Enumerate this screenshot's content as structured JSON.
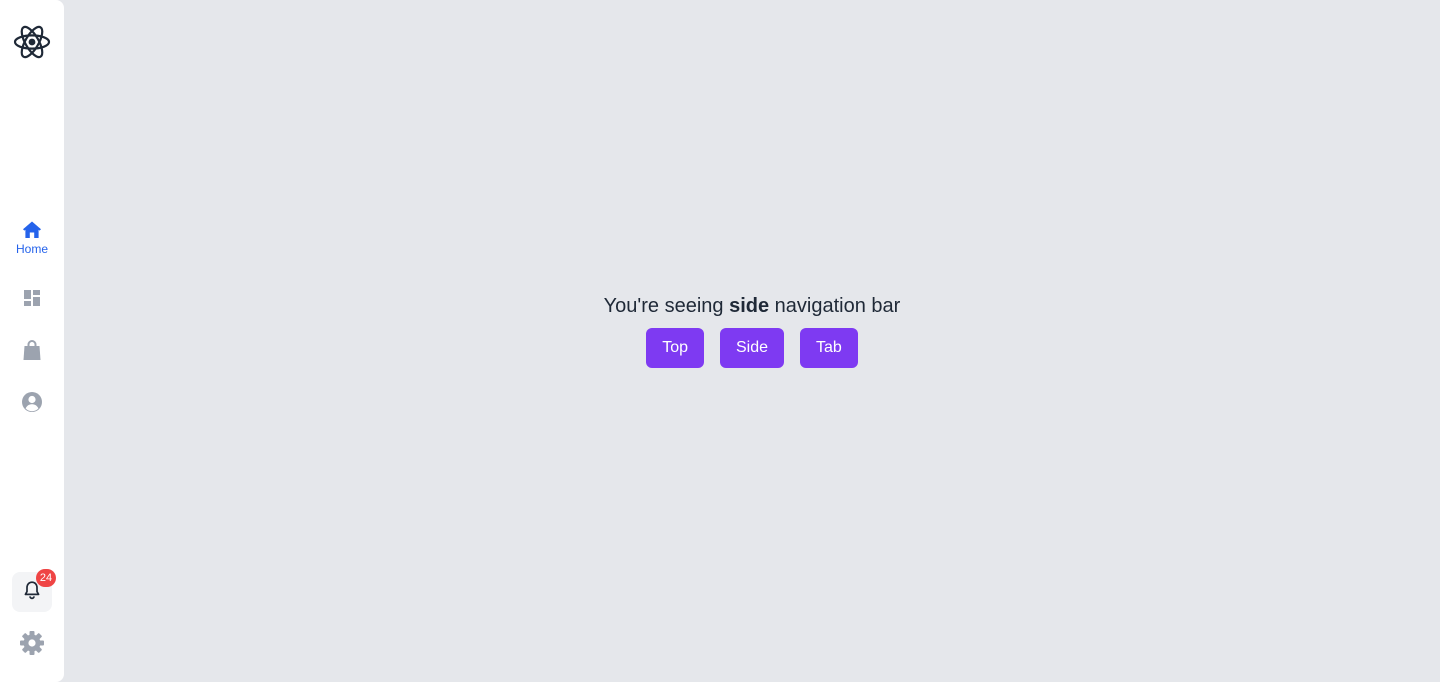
{
  "sidebar": {
    "logo_icon": "react-atom-icon",
    "items": [
      {
        "icon": "home-icon",
        "label": "Home",
        "active": true
      },
      {
        "icon": "dashboard-icon",
        "label": "",
        "active": false
      },
      {
        "icon": "shopping-bag-icon",
        "label": "",
        "active": false
      },
      {
        "icon": "user-circle-icon",
        "label": "",
        "active": false
      }
    ],
    "notifications": {
      "icon": "bell-icon",
      "count": "24"
    },
    "settings": {
      "icon": "gear-icon"
    }
  },
  "main": {
    "message_prefix": "You're seeing ",
    "message_bold": "side",
    "message_suffix": " navigation bar",
    "buttons": [
      {
        "label": "Top"
      },
      {
        "label": "Side"
      },
      {
        "label": "Tab"
      }
    ]
  },
  "colors": {
    "background": "#e5e7eb",
    "sidebar": "#ffffff",
    "active": "#2563eb",
    "inactive_icon": "#9ca3af",
    "button": "#7e3af2",
    "badge": "#ef4444"
  }
}
